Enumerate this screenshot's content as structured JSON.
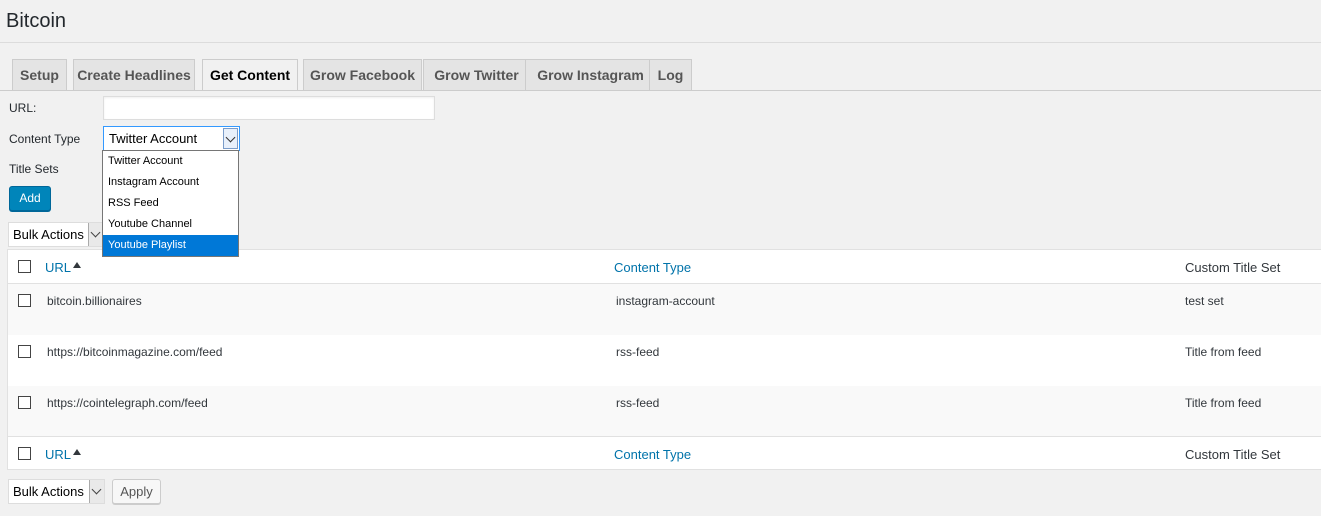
{
  "page": {
    "title": "Bitcoin"
  },
  "tabs": [
    {
      "label": "Setup",
      "active": false
    },
    {
      "label": "Create Headlines",
      "active": false
    },
    {
      "label": "Get Content",
      "active": true
    },
    {
      "label": "Grow Facebook",
      "active": false
    },
    {
      "label": "Grow Twitter",
      "active": false
    },
    {
      "label": "Grow Instagram",
      "active": false
    },
    {
      "label": "Log",
      "active": false
    }
  ],
  "form": {
    "url_label": "URL:",
    "url_value": "",
    "content_type_label": "Content Type",
    "content_type_value": "Twitter Account",
    "content_type_options": [
      "Twitter Account",
      "Instagram Account",
      "RSS Feed",
      "Youtube Channel",
      "Youtube Playlist"
    ],
    "highlighted_option": "Youtube Playlist",
    "title_sets_label": "Title Sets",
    "add_label": "Add"
  },
  "bulk": {
    "top_label": "Bulk Actions",
    "bottom_label": "Bulk Actions",
    "apply_label": "Apply"
  },
  "table": {
    "columns": [
      "URL",
      "Content Type",
      "Custom Title Set"
    ],
    "rows": [
      {
        "url": "bitcoin.billionaires",
        "content_type": "instagram-account",
        "title_set": "test set"
      },
      {
        "url": "https://bitcoinmagazine.com/feed",
        "content_type": "rss-feed",
        "title_set": "Title from feed"
      },
      {
        "url": "https://cointelegraph.com/feed",
        "content_type": "rss-feed",
        "title_set": "Title from feed"
      }
    ]
  },
  "colors": {
    "primary_button": "#0085ba",
    "link": "#0073aa",
    "dropdown_highlight": "#0078d7"
  },
  "icons": {
    "sort": "sort-ascending-icon",
    "dropdown": "chevron-down-icon"
  }
}
